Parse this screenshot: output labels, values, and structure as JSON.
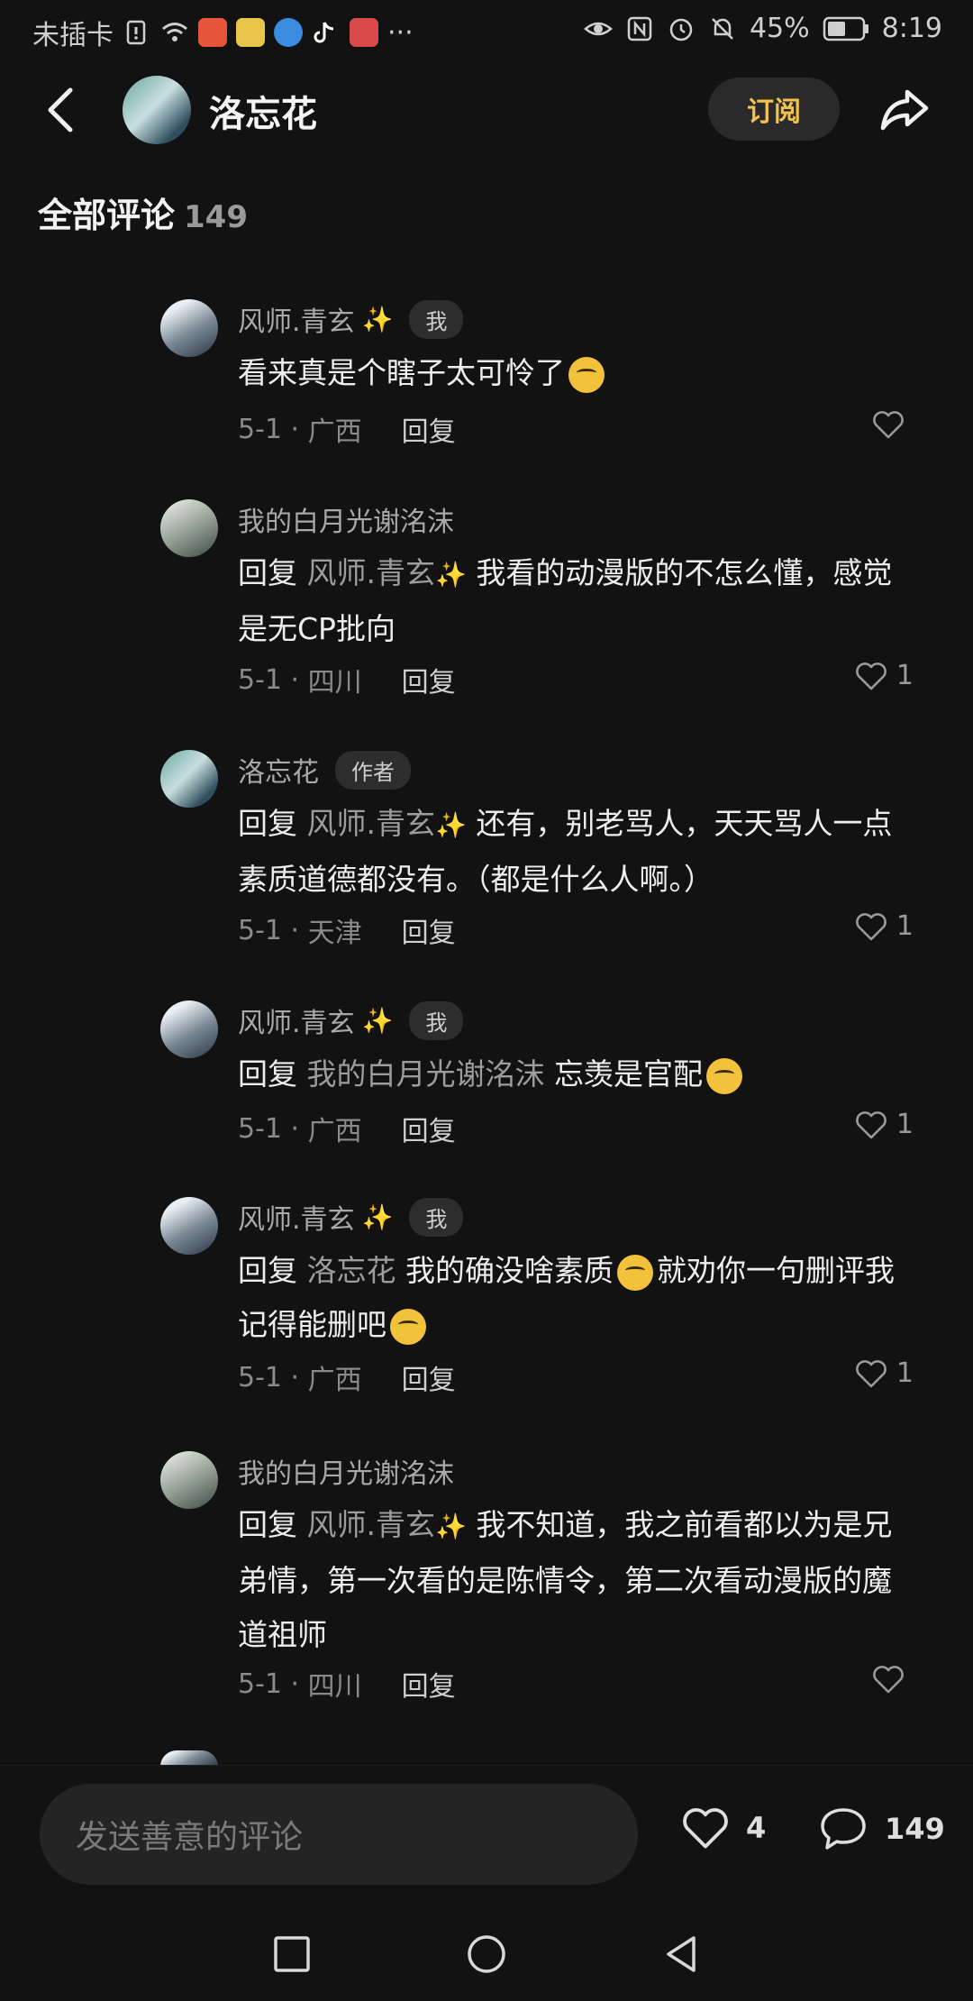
{
  "status": {
    "carrier": "未插卡",
    "battery": "45%",
    "time": "8:19"
  },
  "header": {
    "title": "洛忘花",
    "subscribe_label": "订阅"
  },
  "section": {
    "title": "全部评论",
    "count": "149"
  },
  "comments": [
    {
      "author": "风师.青玄",
      "author_spark": "✨",
      "badge": "我",
      "text_main": "看来真是个瞎子太可怜了",
      "date": "5-1",
      "location": "广西",
      "reply_label": "回复",
      "likes": ""
    },
    {
      "author": "我的白月光谢洺沫",
      "badge": "",
      "reply_prefix": "回复",
      "reply_to": "风师.青玄",
      "reply_spark": "✨",
      "text_main": "我看的动漫版的不怎么懂，感觉是无CP批向",
      "date": "5-1",
      "location": "四川",
      "reply_label": "回复",
      "likes": "1"
    },
    {
      "author": "洛忘花",
      "badge": "作者",
      "reply_prefix": "回复",
      "reply_to": "风师.青玄",
      "reply_spark": "✨",
      "text_main": "还有，别老骂人，天天骂人一点素质道德都没有。（都是什么人啊。）",
      "date": "5-1",
      "location": "天津",
      "reply_label": "回复",
      "likes": "1"
    },
    {
      "author": "风师.青玄",
      "author_spark": "✨",
      "badge": "我",
      "reply_prefix": "回复",
      "reply_to": "我的白月光谢洺沫",
      "text_main": "忘羡是官配",
      "date": "5-1",
      "location": "广西",
      "reply_label": "回复",
      "likes": "1"
    },
    {
      "author": "风师.青玄",
      "author_spark": "✨",
      "badge": "我",
      "reply_prefix": "回复",
      "reply_to": "洛忘花",
      "text_main": "我的确没啥素质",
      "text_tail": "就劝你一句删评我记得能删吧",
      "date": "5-1",
      "location": "广西",
      "reply_label": "回复",
      "likes": "1"
    },
    {
      "author": "我的白月光谢洺沫",
      "badge": "",
      "reply_prefix": "回复",
      "reply_to": "风师.青玄",
      "reply_spark": "✨",
      "text_main": "我不知道，我之前看都以为是兄弟情，第一次看的是陈情令，第二次看动漫版的魔道祖师",
      "date": "5-1",
      "location": "四川",
      "reply_label": "回复",
      "likes": ""
    }
  ],
  "bottom": {
    "input_placeholder": "发送善意的评论",
    "like_count": "4",
    "comment_count": "149"
  },
  "icons": {
    "accent_gold": "#f2c24e",
    "spark_yellow": "#f7d34a"
  }
}
